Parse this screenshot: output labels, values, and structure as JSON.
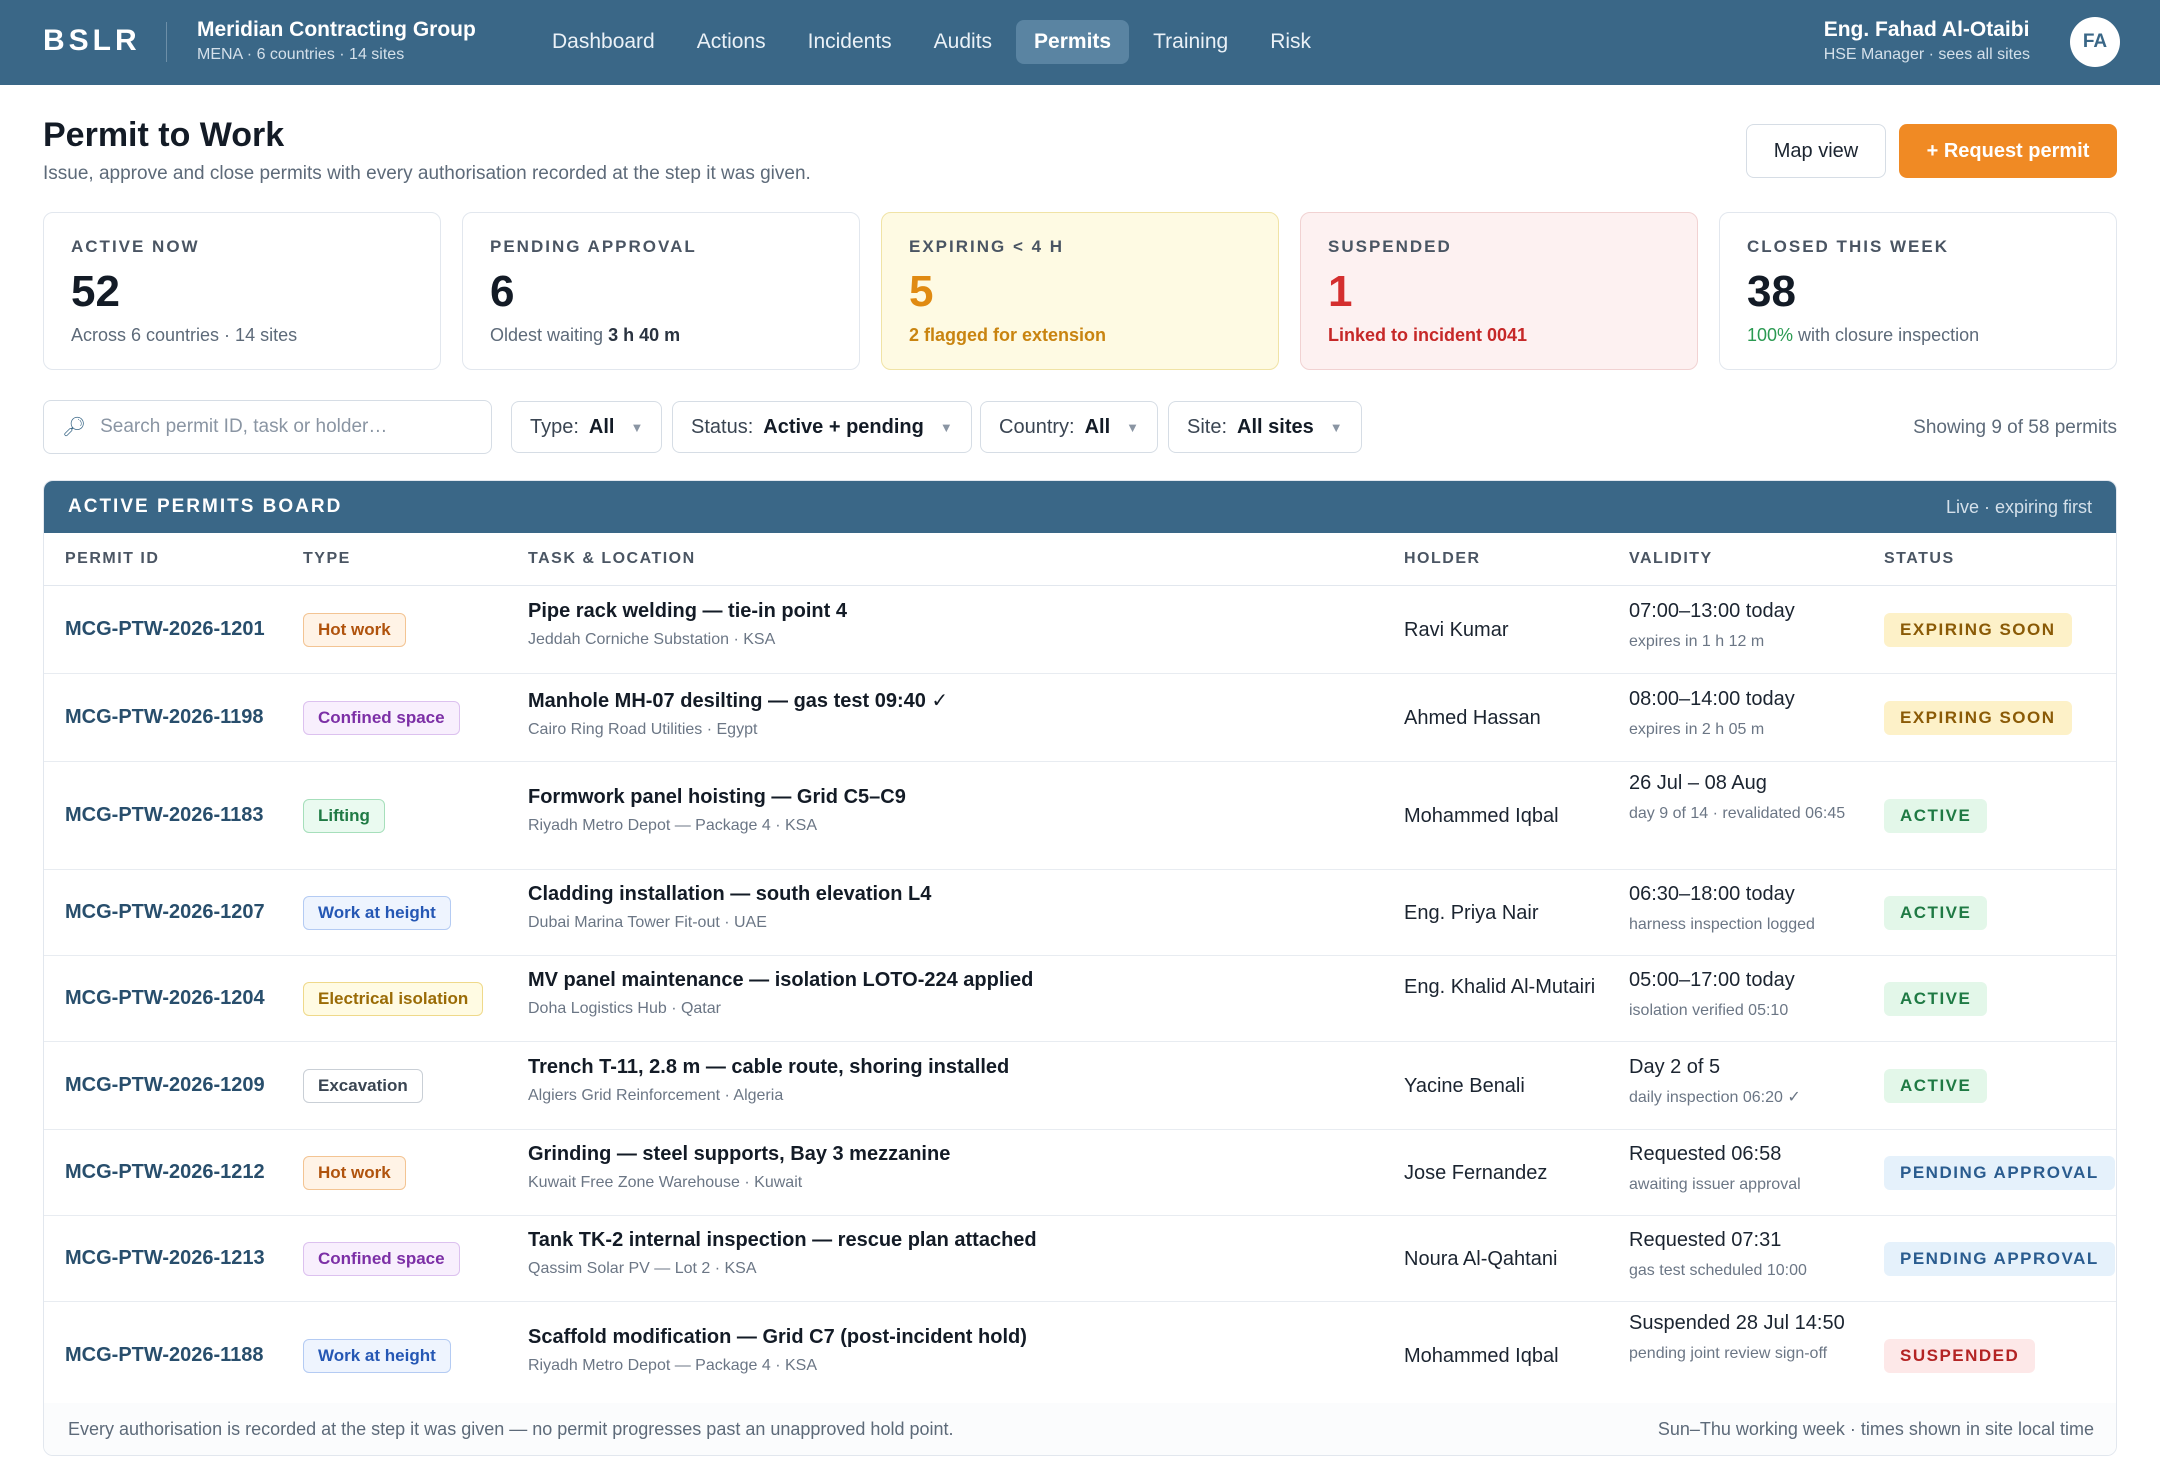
{
  "header": {
    "brand": "BSLR",
    "org_name": "Meridian Contracting Group",
    "org_sub": "MENA · 6 countries · 14 sites",
    "nav": [
      "Dashboard",
      "Actions",
      "Incidents",
      "Audits",
      "Permits",
      "Training",
      "Risk"
    ],
    "active_nav": "Permits",
    "user_name": "Eng. Fahad Al-Otaibi",
    "user_role": "HSE Manager · sees all sites",
    "avatar": "FA"
  },
  "page": {
    "title": "Permit to Work",
    "subtitle": "Issue, approve and close permits with every authorisation recorded at the step it was given.",
    "map_button": "Map view",
    "request_button": "+ Request permit"
  },
  "kpis": [
    {
      "label": "ACTIVE NOW",
      "value": "52",
      "note_pre": "Across 6 countries · 14 sites",
      "note_bold": "",
      "variant": ""
    },
    {
      "label": "PENDING APPROVAL",
      "value": "6",
      "note_pre": "Oldest waiting ",
      "note_bold": "3 h 40 m",
      "variant": ""
    },
    {
      "label": "EXPIRING < 4 H",
      "value": "5",
      "note_pre": "2 flagged for extension",
      "note_bold": "",
      "variant": "warn"
    },
    {
      "label": "SUSPENDED",
      "value": "1",
      "note_pre": "Linked to incident 0041",
      "note_bold": "",
      "variant": "danger"
    },
    {
      "label": "CLOSED THIS WEEK",
      "value": "38",
      "note_pct": "100%",
      "note_pre": " with closure inspection",
      "note_bold": "",
      "variant": ""
    }
  ],
  "filters": {
    "search_placeholder": "Search permit ID, task or holder…",
    "type_label": "Type:",
    "type_value": "All",
    "status_label": "Status:",
    "status_value": "Active + pending",
    "country_label": "Country:",
    "country_value": "All",
    "site_label": "Site:",
    "site_value": "All sites",
    "showing": "Showing 9 of 58 permits"
  },
  "board": {
    "title": "ACTIVE PERMITS BOARD",
    "live": "Live · expiring first",
    "columns": [
      "PERMIT ID",
      "TYPE",
      "TASK & LOCATION",
      "HOLDER",
      "VALIDITY",
      "STATUS"
    ],
    "rows": [
      {
        "id": "MCG-PTW-2026-1201",
        "type": "Hot work",
        "tone": "orange",
        "task": "Pipe rack welding — tie-in point 4",
        "loc": "Jeddah Corniche Substation · KSA",
        "holder": "Ravi Kumar",
        "valid": "07:00–13:00 today",
        "valid_sub": "expires in 1 h 12 m",
        "status": "EXPIRING SOON",
        "status_tone": "amber"
      },
      {
        "id": "MCG-PTW-2026-1198",
        "type": "Confined space",
        "tone": "purple",
        "task": "Manhole MH-07 desilting — gas test 09:40 ✓",
        "loc": "Cairo Ring Road Utilities · Egypt",
        "holder": "Ahmed Hassan",
        "valid": "08:00–14:00 today",
        "valid_sub": "expires in 2 h 05 m",
        "status": "EXPIRING SOON",
        "status_tone": "amber"
      },
      {
        "id": "MCG-PTW-2026-1183",
        "type": "Lifting",
        "tone": "green",
        "task": "Formwork panel hoisting — Grid C5–C9",
        "loc": "Riyadh Metro Depot — Package 4 · KSA",
        "holder": "Mohammed Iqbal",
        "valid": "26 Jul – 08 Aug",
        "valid_sub": "day 9 of 14 · revalidated 06:45",
        "status": "ACTIVE",
        "status_tone": "green"
      },
      {
        "id": "MCG-PTW-2026-1207",
        "type": "Work at height",
        "tone": "blue",
        "task": "Cladding installation — south elevation L4",
        "loc": "Dubai Marina Tower Fit-out · UAE",
        "holder": "Eng. Priya Nair",
        "valid": "06:30–18:00 today",
        "valid_sub": "harness inspection logged",
        "status": "ACTIVE",
        "status_tone": "green"
      },
      {
        "id": "MCG-PTW-2026-1204",
        "type": "Electrical isolation",
        "tone": "yellow",
        "task": "MV panel maintenance — isolation LOTO-224 applied",
        "loc": "Doha Logistics Hub · Qatar",
        "holder": "Eng. Khalid Al-Mutairi",
        "valid": "05:00–17:00 today",
        "valid_sub": "isolation verified 05:10",
        "status": "ACTIVE",
        "status_tone": "green"
      },
      {
        "id": "MCG-PTW-2026-1209",
        "type": "Excavation",
        "tone": "grey",
        "task": "Trench T-11, 2.8 m — cable route, shoring installed",
        "loc": "Algiers Grid Reinforcement · Algeria",
        "holder": "Yacine Benali",
        "valid": "Day 2 of 5",
        "valid_sub": "daily inspection 06:20 ✓",
        "status": "ACTIVE",
        "status_tone": "green"
      },
      {
        "id": "MCG-PTW-2026-1212",
        "type": "Hot work",
        "tone": "orange",
        "task": "Grinding — steel supports, Bay 3 mezzanine",
        "loc": "Kuwait Free Zone Warehouse · Kuwait",
        "holder": "Jose Fernandez",
        "valid": "Requested 06:58",
        "valid_sub": "awaiting issuer approval",
        "status": "PENDING APPROVAL",
        "status_tone": "blue"
      },
      {
        "id": "MCG-PTW-2026-1213",
        "type": "Confined space",
        "tone": "purple",
        "task": "Tank TK-2 internal inspection — rescue plan attached",
        "loc": "Qassim Solar PV — Lot 2 · KSA",
        "holder": "Noura Al-Qahtani",
        "valid": "Requested 07:31",
        "valid_sub": "gas test scheduled 10:00",
        "status": "PENDING APPROVAL",
        "status_tone": "blue"
      },
      {
        "id": "MCG-PTW-2026-1188",
        "type": "Work at height",
        "tone": "blue",
        "task": "Scaffold modification — Grid C7 (post-incident hold)",
        "loc": "Riyadh Metro Depot — Package 4 · KSA",
        "holder": "Mohammed Iqbal",
        "valid": "Suspended 28 Jul 14:50",
        "valid_sub": "pending joint review sign-off",
        "status": "SUSPENDED",
        "status_tone": "red"
      }
    ],
    "footer_left": "Every authorisation is recorded at the step it was given — no permit progresses past an unapproved hold point.",
    "footer_right": "Sun–Thu working week · times shown in site local time"
  },
  "colors": {
    "accent": "#3a6787",
    "request": "#f08a24"
  }
}
